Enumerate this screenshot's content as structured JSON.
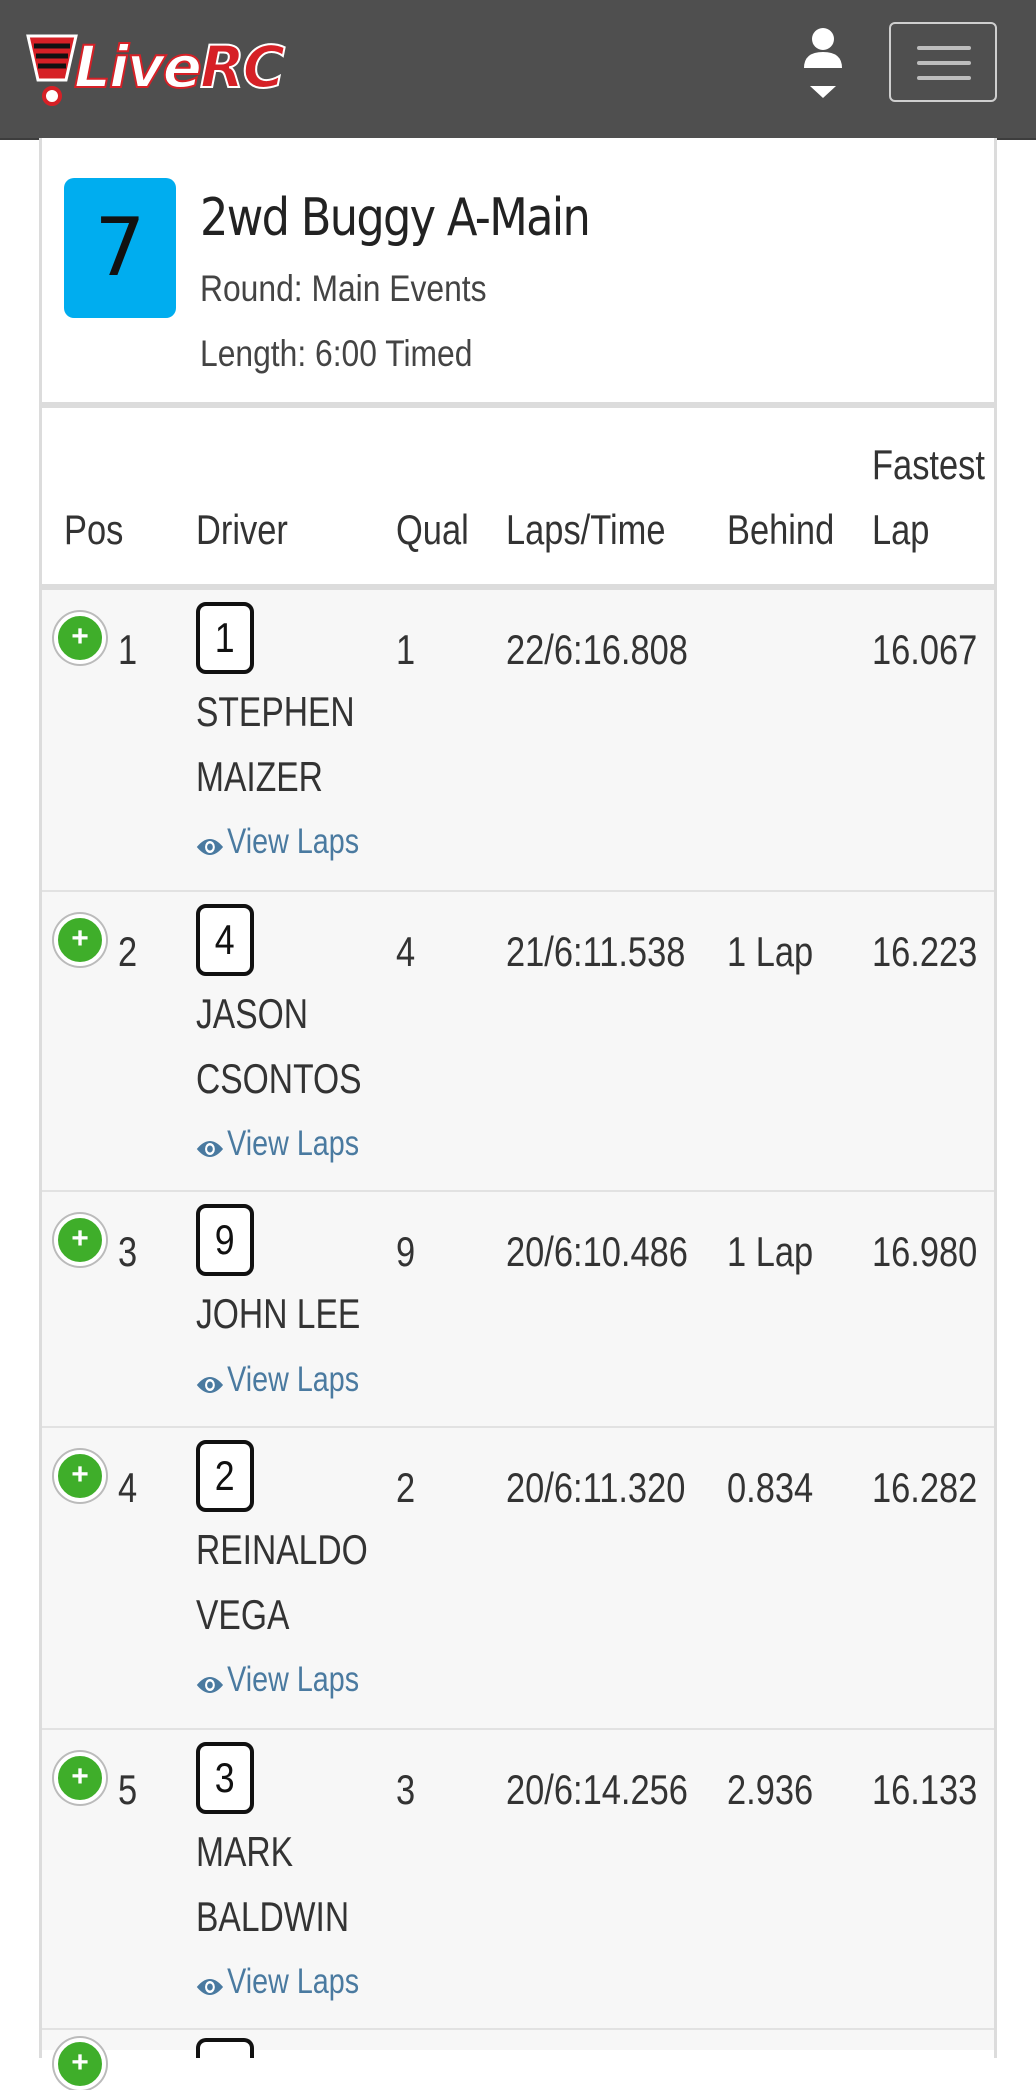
{
  "header": {
    "logo_text_live": "Live",
    "logo_text_rc": "RC",
    "brand_red": "#d62026",
    "navbar_bg": "#4f4f4f"
  },
  "race": {
    "number": "7",
    "title": "2wd Buggy A-Main",
    "round": "Round: Main Events",
    "length": "Length: 6:00 Timed",
    "number_bg": "#00adef"
  },
  "table": {
    "columns": {
      "pos": "Pos",
      "driver": "Driver",
      "qual": "Qual",
      "laps_time": "Laps/Time",
      "behind": "Behind",
      "fastest_line1": "Fastest",
      "fastest_line2": "Lap"
    },
    "view_laps_label": "View Laps",
    "rows": [
      {
        "pos": "1",
        "car": "1",
        "name_line1": "STEPHEN",
        "name_line2": "MAIZER",
        "qual": "1",
        "laps_time": "22/6:16.808",
        "behind": "",
        "fastest": "16.067"
      },
      {
        "pos": "2",
        "car": "4",
        "name_line1": "JASON",
        "name_line2": "CSONTOS",
        "qual": "4",
        "laps_time": "21/6:11.538",
        "behind": "1 Lap",
        "fastest": "16.223"
      },
      {
        "pos": "3",
        "car": "9",
        "name_line1": "JOHN LEE",
        "name_line2": "",
        "qual": "9",
        "laps_time": "20/6:10.486",
        "behind": "1 Lap",
        "fastest": "16.980"
      },
      {
        "pos": "4",
        "car": "2",
        "name_line1": "REINALDO",
        "name_line2": "VEGA",
        "qual": "2",
        "laps_time": "20/6:11.320",
        "behind": "0.834",
        "fastest": "16.282"
      },
      {
        "pos": "5",
        "car": "3",
        "name_line1": "MARK",
        "name_line2": "BALDWIN",
        "qual": "3",
        "laps_time": "20/6:14.256",
        "behind": "2.936",
        "fastest": "16.133"
      }
    ],
    "expand_color": "#3fae2a",
    "link_color": "#4a7aa0"
  }
}
